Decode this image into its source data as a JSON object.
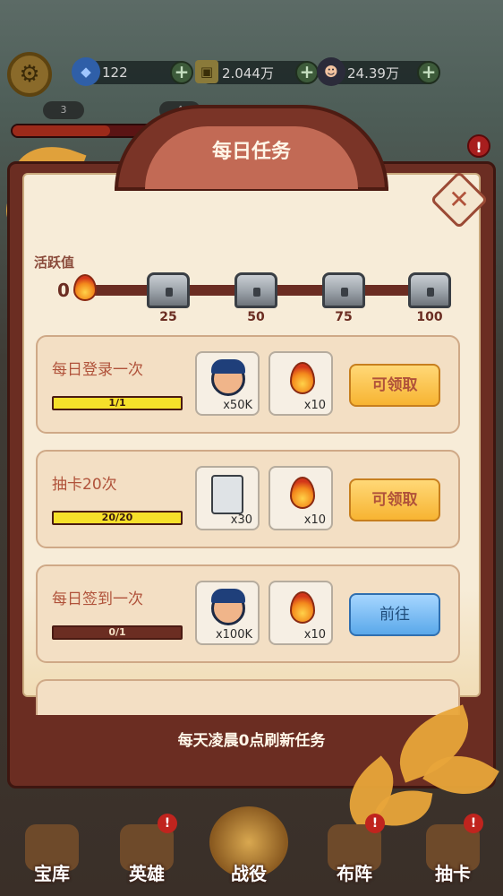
{
  "resources": [
    {
      "icon": "gem-icon",
      "value": "122"
    },
    {
      "icon": "coin-icon",
      "value": "2.044万"
    },
    {
      "icon": "hero-head-icon",
      "value": "24.39万"
    }
  ],
  "sub_pills": [
    "3",
    "4"
  ],
  "panel": {
    "title": "每日任务",
    "footer": "每天凌晨0点刷新任务"
  },
  "activity": {
    "label": "活跃值",
    "value": "0",
    "progress": 0,
    "milestones": [
      "25",
      "50",
      "75",
      "100"
    ]
  },
  "tasks": [
    {
      "title": "每日登录一次",
      "progress_text": "1/1",
      "progress": 1.0,
      "rewards": [
        {
          "icon": "hero-head-icon",
          "qty": "x50K"
        },
        {
          "icon": "flame-icon",
          "qty": "x10"
        }
      ],
      "button": "可领取",
      "button_type": "claim"
    },
    {
      "title": "抽卡20次",
      "progress_text": "20/20",
      "progress": 1.0,
      "rewards": [
        {
          "icon": "summon-card-icon",
          "qty": "x30"
        },
        {
          "icon": "flame-icon",
          "qty": "x10"
        }
      ],
      "button": "可领取",
      "button_type": "claim"
    },
    {
      "title": "每日签到一次",
      "progress_text": "0/1",
      "progress": 0.0,
      "rewards": [
        {
          "icon": "hero-head-icon",
          "qty": "x100K"
        },
        {
          "icon": "flame-icon",
          "qty": "x10"
        }
      ],
      "button": "前往",
      "button_type": "go"
    }
  ],
  "nav": [
    {
      "label": "宝库",
      "badge": ""
    },
    {
      "label": "英雄",
      "badge": "!"
    },
    {
      "label": "战役",
      "badge": ""
    },
    {
      "label": "布阵",
      "badge": "!"
    },
    {
      "label": "抽卡",
      "badge": "!"
    }
  ],
  "notification_badge": "!",
  "colors": {
    "panel_frame": "#6b2d22",
    "panel_bg": "#f7ecd8",
    "claim_button": "#f7b432",
    "go_button": "#5aa8ea",
    "progress_fill": "#f6e02a"
  }
}
